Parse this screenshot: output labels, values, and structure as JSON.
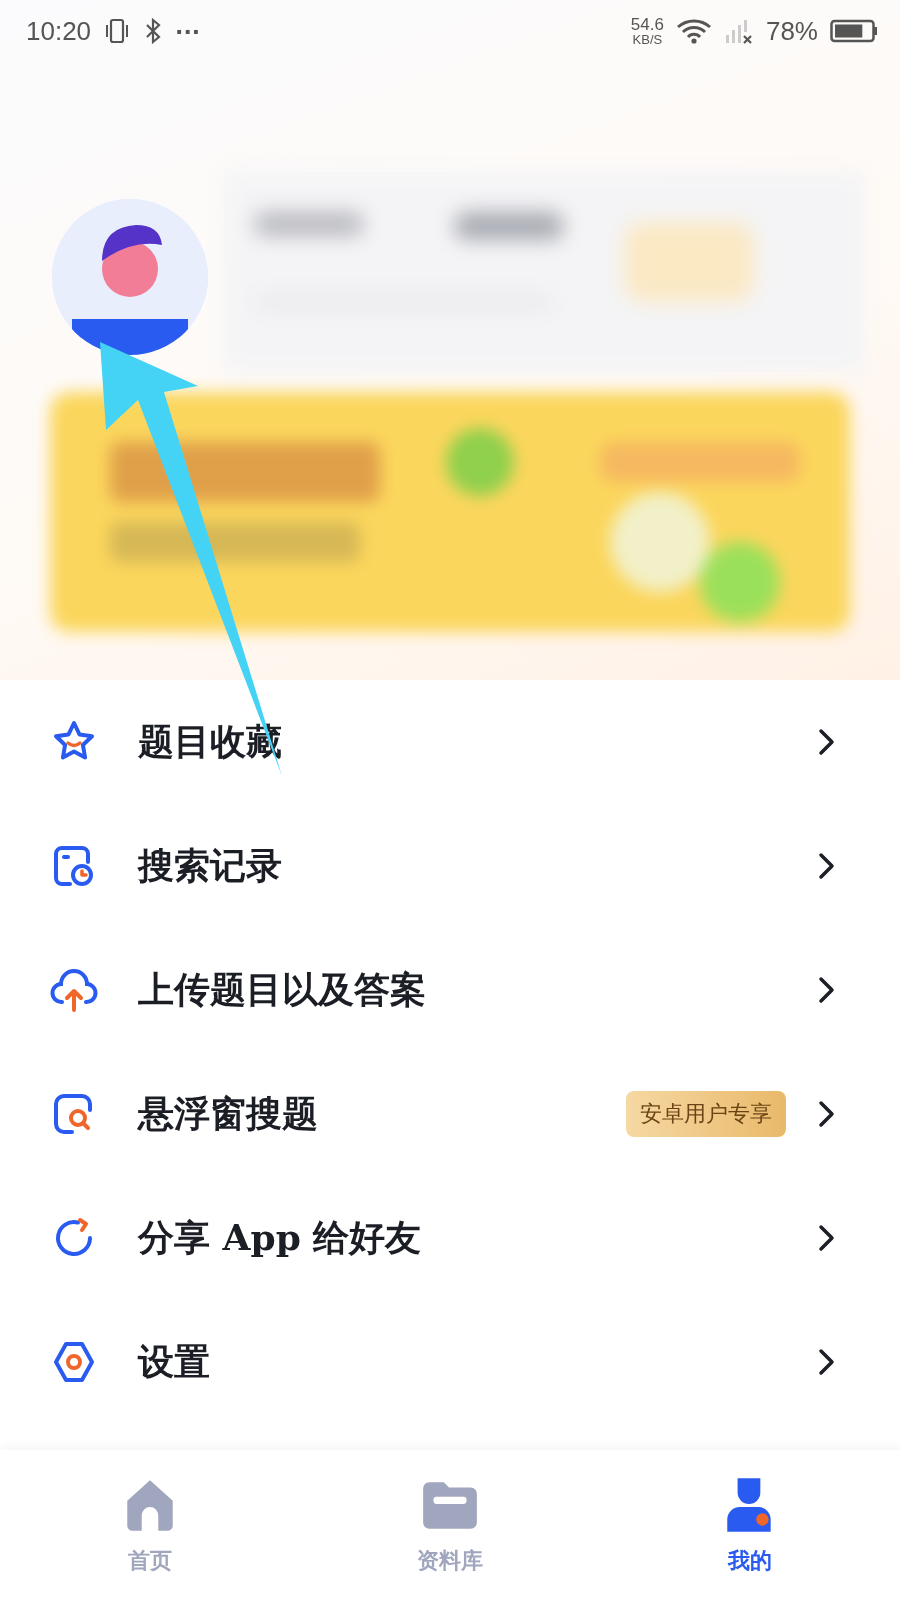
{
  "status_bar": {
    "time": "10:20",
    "more": "···",
    "speed_value": "54.6",
    "speed_unit": "KB/S",
    "battery": "78%"
  },
  "menu": [
    {
      "kind": "star",
      "label": "题目收藏"
    },
    {
      "kind": "history",
      "label": "搜索记录"
    },
    {
      "kind": "upload",
      "label": "上传题目以及答案"
    },
    {
      "kind": "float",
      "label": "悬浮窗搜题",
      "badge": "安卓用户专享"
    },
    {
      "kind": "share",
      "label": "分享 App 给好友"
    },
    {
      "kind": "settings",
      "label": "设置"
    }
  ],
  "tabs": [
    {
      "kind": "home",
      "label": "首页",
      "selected": false
    },
    {
      "kind": "folder",
      "label": "资料库",
      "selected": false
    },
    {
      "kind": "me",
      "label": "我的",
      "selected": true
    }
  ]
}
